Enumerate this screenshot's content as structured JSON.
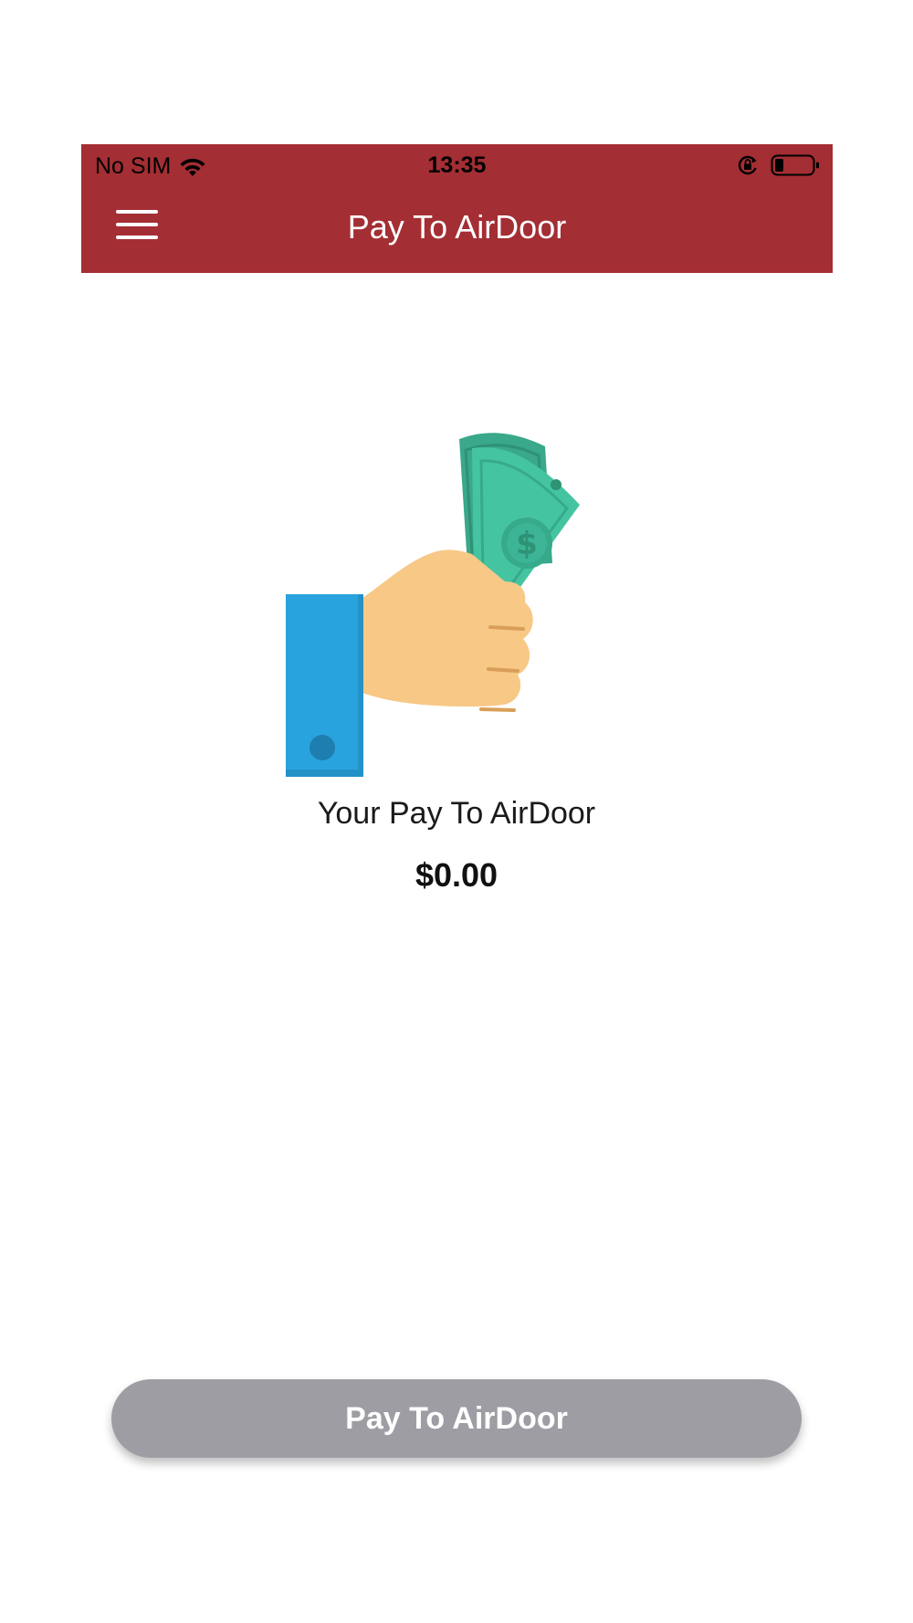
{
  "status_bar": {
    "carrier": "No SIM",
    "time": "13:35",
    "icons": [
      "wifi-icon",
      "orientation-lock-icon",
      "battery-icon"
    ]
  },
  "navbar": {
    "menu_icon": "hamburger-menu-icon",
    "title": "Pay To AirDoor"
  },
  "content": {
    "illustration": "hand-holding-money-illustration",
    "caption": "Your Pay To AirDoor",
    "amount": "$0.00"
  },
  "actions": {
    "pay_button_label": "Pay To AirDoor"
  },
  "colors": {
    "header": "#a32e33",
    "button_disabled": "#9d9da3",
    "money_green": "#44c4a1",
    "sleeve_blue": "#29a3dd",
    "skin": "#f7c886"
  }
}
